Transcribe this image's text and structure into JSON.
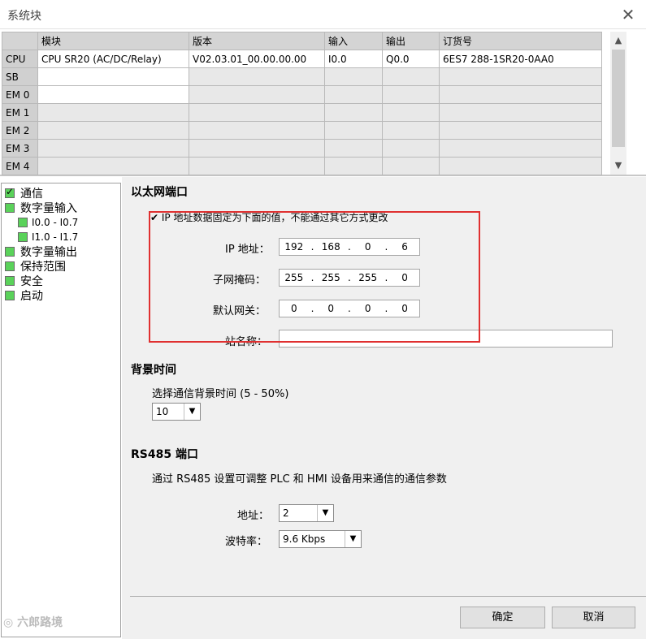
{
  "window": {
    "title": "系统块"
  },
  "module_table": {
    "columns": [
      "模块",
      "版本",
      "输入",
      "输出",
      "订货号"
    ],
    "rows": [
      {
        "label": "CPU",
        "module": "CPU SR20 (AC/DC/Relay)",
        "version": "V02.03.01_00.00.00.00",
        "input": "I0.0",
        "output": "Q0.0",
        "order": "6ES7 288-1SR20-0AA0"
      },
      {
        "label": "SB",
        "module": "",
        "version": "",
        "input": "",
        "output": "",
        "order": ""
      },
      {
        "label": "EM 0",
        "module": "",
        "version": "",
        "input": "",
        "output": "",
        "order": ""
      },
      {
        "label": "EM 1",
        "module": "",
        "version": "",
        "input": "",
        "output": "",
        "order": ""
      },
      {
        "label": "EM 2",
        "module": "",
        "version": "",
        "input": "",
        "output": "",
        "order": ""
      },
      {
        "label": "EM 3",
        "module": "",
        "version": "",
        "input": "",
        "output": "",
        "order": ""
      },
      {
        "label": "EM 4",
        "module": "",
        "version": "",
        "input": "",
        "output": "",
        "order": ""
      }
    ]
  },
  "tree": {
    "items": [
      {
        "label": "通信"
      },
      {
        "label": "数字量输入"
      },
      {
        "label": "I0.0 - I0.7"
      },
      {
        "label": "I1.0 - I1.7"
      },
      {
        "label": "数字量输出"
      },
      {
        "label": "保持范围"
      },
      {
        "label": "安全"
      },
      {
        "label": "启动"
      }
    ]
  },
  "ethernet": {
    "heading": "以太网端口",
    "fixed_checkbox": "IP 地址数据固定为下面的值，不能通过其它方式更改",
    "ip_label": "IP 地址：",
    "ip": [
      "192",
      "168",
      "0",
      "6"
    ],
    "mask_label": "子网掩码：",
    "mask": [
      "255",
      "255",
      "255",
      "0"
    ],
    "gateway_label": "默认网关：",
    "gateway": [
      "0",
      "0",
      "0",
      "0"
    ],
    "station_label": "站名称：",
    "station_value": ""
  },
  "background": {
    "heading": "背景时间",
    "desc": "选择通信背景时间 (5 - 50%)",
    "value": "10"
  },
  "rs485": {
    "heading": "RS485 端口",
    "desc": "通过 RS485 设置可调整 PLC 和 HMI 设备用来通信的通信参数",
    "address_label": "地址：",
    "address_value": "2",
    "baud_label": "波特率：",
    "baud_value": "9.6 Kbps"
  },
  "buttons": {
    "ok": "确定",
    "cancel": "取消"
  },
  "watermark": "六郎路境",
  "colors": {
    "highlight_box": "#e03030",
    "tree_node_box": "#5ad25a"
  }
}
